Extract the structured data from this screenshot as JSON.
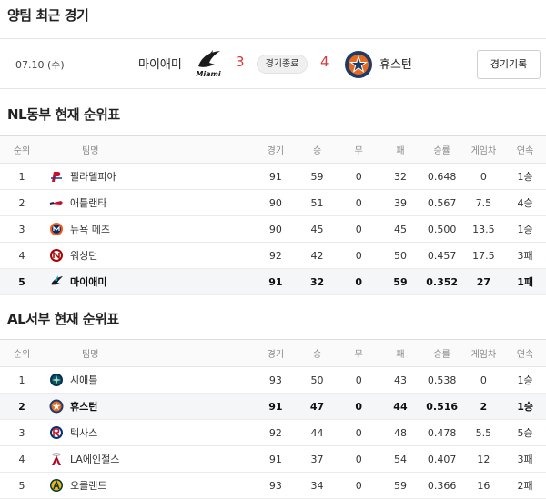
{
  "sections": {
    "recent": "양팀 최근 경기",
    "nl": "NL동부 현재 순위표",
    "al": "AL서부 현재 순위표"
  },
  "game": {
    "date": "07.10 (수)",
    "away_team": "마이애미",
    "away_score": "3",
    "status": "경기종료",
    "home_score": "4",
    "home_team": "휴스턴",
    "record_button": "경기기록",
    "marlins_logo_text": "Miami"
  },
  "columns": [
    "순위",
    "팀명",
    "경기",
    "승",
    "무",
    "패",
    "승률",
    "게임차",
    "연속"
  ],
  "nl_rows": [
    {
      "rank": "1",
      "team": "필라델피아",
      "g": "91",
      "w": "59",
      "d": "0",
      "l": "32",
      "pct": "0.648",
      "gb": "0",
      "streak": "1승",
      "logo": "phillies-logo"
    },
    {
      "rank": "2",
      "team": "애틀랜타",
      "g": "90",
      "w": "51",
      "d": "0",
      "l": "39",
      "pct": "0.567",
      "gb": "7.5",
      "streak": "4승",
      "logo": "braves-logo"
    },
    {
      "rank": "3",
      "team": "뉴욕 메츠",
      "g": "90",
      "w": "45",
      "d": "0",
      "l": "45",
      "pct": "0.500",
      "gb": "13.5",
      "streak": "1승",
      "logo": "mets-logo"
    },
    {
      "rank": "4",
      "team": "워싱턴",
      "g": "92",
      "w": "42",
      "d": "0",
      "l": "50",
      "pct": "0.457",
      "gb": "17.5",
      "streak": "3패",
      "logo": "nationals-logo"
    },
    {
      "rank": "5",
      "team": "마이애미",
      "g": "91",
      "w": "32",
      "d": "0",
      "l": "59",
      "pct": "0.352",
      "gb": "27",
      "streak": "1패",
      "logo": "marlins-logo"
    }
  ],
  "al_rows": [
    {
      "rank": "1",
      "team": "시애틀",
      "g": "93",
      "w": "50",
      "d": "0",
      "l": "43",
      "pct": "0.538",
      "gb": "0",
      "streak": "1승",
      "logo": "mariners-logo"
    },
    {
      "rank": "2",
      "team": "휴스턴",
      "g": "91",
      "w": "47",
      "d": "0",
      "l": "44",
      "pct": "0.516",
      "gb": "2",
      "streak": "1승",
      "logo": "astros-logo"
    },
    {
      "rank": "3",
      "team": "텍사스",
      "g": "92",
      "w": "44",
      "d": "0",
      "l": "48",
      "pct": "0.478",
      "gb": "5.5",
      "streak": "5승",
      "logo": "rangers-logo"
    },
    {
      "rank": "4",
      "team": "LA에인절스",
      "g": "91",
      "w": "37",
      "d": "0",
      "l": "54",
      "pct": "0.407",
      "gb": "12",
      "streak": "3패",
      "logo": "angels-logo"
    },
    {
      "rank": "5",
      "team": "오클랜드",
      "g": "93",
      "w": "34",
      "d": "0",
      "l": "59",
      "pct": "0.366",
      "gb": "16",
      "streak": "2패",
      "logo": "athletics-logo"
    }
  ],
  "colors": {
    "score_red": "#d43c3c",
    "highlight_row": "#f5f6f8",
    "header_bg": "#fafafa"
  }
}
